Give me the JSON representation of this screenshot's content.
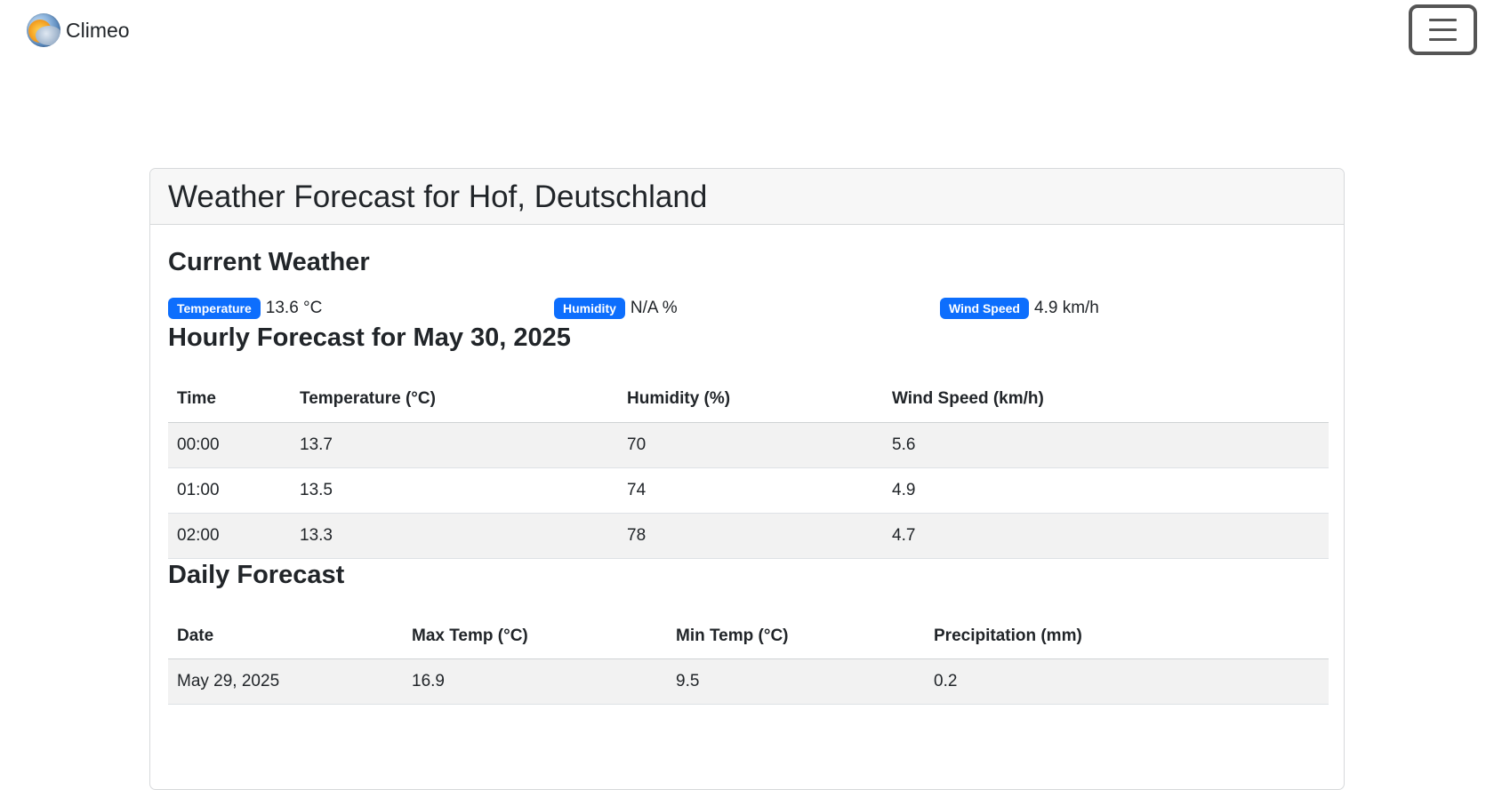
{
  "navbar": {
    "brand": "Climeo",
    "logo_icon": "sun-cloud-logo-icon",
    "menu_icon": "hamburger-menu-icon"
  },
  "card": {
    "title": "Weather Forecast for Hof, Deutschland"
  },
  "current": {
    "title": "Current Weather",
    "items": [
      {
        "label": "Temperature",
        "value": "13.6 °C"
      },
      {
        "label": "Humidity",
        "value": "N/A %"
      },
      {
        "label": "Wind Speed",
        "value": "4.9 km/h"
      }
    ]
  },
  "hourly": {
    "title": "Hourly Forecast for May 30, 2025",
    "headers": [
      "Time",
      "Temperature (°C)",
      "Humidity (%)",
      "Wind Speed (km/h)"
    ],
    "rows": [
      [
        "00:00",
        "13.7",
        "70",
        "5.6"
      ],
      [
        "01:00",
        "13.5",
        "74",
        "4.9"
      ],
      [
        "02:00",
        "13.3",
        "78",
        "4.7"
      ]
    ]
  },
  "daily": {
    "title": "Daily Forecast",
    "headers": [
      "Date",
      "Max Temp (°C)",
      "Min Temp (°C)",
      "Precipitation (mm)"
    ],
    "rows": [
      [
        "May 29, 2025",
        "16.9",
        "9.5",
        "0.2"
      ]
    ]
  },
  "colors": {
    "badge": "#0d6efd",
    "stripe": "#f2f2f2",
    "header_bg": "#f7f7f7"
  }
}
